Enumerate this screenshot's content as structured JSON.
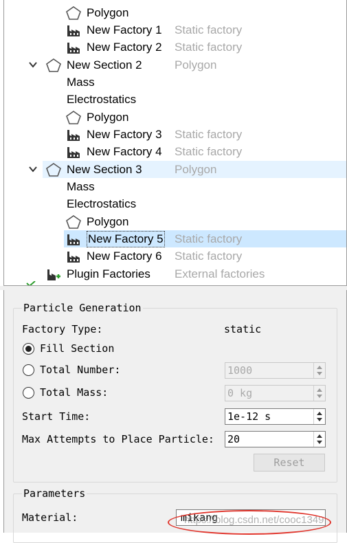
{
  "tree": {
    "rows": [
      {
        "label": "Polygon",
        "sub": ""
      },
      {
        "label": "New Factory 1",
        "sub": "Static factory"
      },
      {
        "label": "New Factory 2",
        "sub": "Static factory"
      },
      {
        "label": "New Section 2",
        "sub": "Polygon"
      },
      {
        "label": "Mass",
        "sub": ""
      },
      {
        "label": "Electrostatics",
        "sub": ""
      },
      {
        "label": "Polygon",
        "sub": ""
      },
      {
        "label": "New Factory 3",
        "sub": "Static factory"
      },
      {
        "label": "New Factory 4",
        "sub": "Static factory"
      },
      {
        "label": "New Section 3",
        "sub": "Polygon"
      },
      {
        "label": "Mass",
        "sub": ""
      },
      {
        "label": "Electrostatics",
        "sub": ""
      },
      {
        "label": "Polygon",
        "sub": ""
      },
      {
        "label": "New Factory 5",
        "sub": "Static factory"
      },
      {
        "label": "New Factory 6",
        "sub": "Static factory"
      },
      {
        "label": "Plugin Factories",
        "sub": "External factories"
      }
    ],
    "selected_label": "New Factory 5",
    "highlighted_section": "New Section 3"
  },
  "particle_generation": {
    "title": "Particle Generation",
    "factory_type_label": "Factory Type:",
    "factory_type_value": "static",
    "fill_section_label": "Fill Section",
    "fill_section_checked": true,
    "total_number_label": "Total Number:",
    "total_number_value": "1000",
    "total_mass_label": "Total Mass:",
    "total_mass_value": "0 kg",
    "start_time_label": "Start Time:",
    "start_time_value": "1e-12 s",
    "max_attempts_label": "Max Attempts to Place Particle:",
    "max_attempts_value": "20",
    "reset_label": "Reset"
  },
  "parameters": {
    "title": "Parameters",
    "material_label": "Material:",
    "material_value": "mikang"
  },
  "watermark": "https://blog.csdn.net/cooc1349",
  "colors": {
    "selection": "#cde8ff",
    "section_highlight": "#e5f3ff",
    "annotation": "#e0332a",
    "subtitle_gray": "#a8a8a8"
  }
}
